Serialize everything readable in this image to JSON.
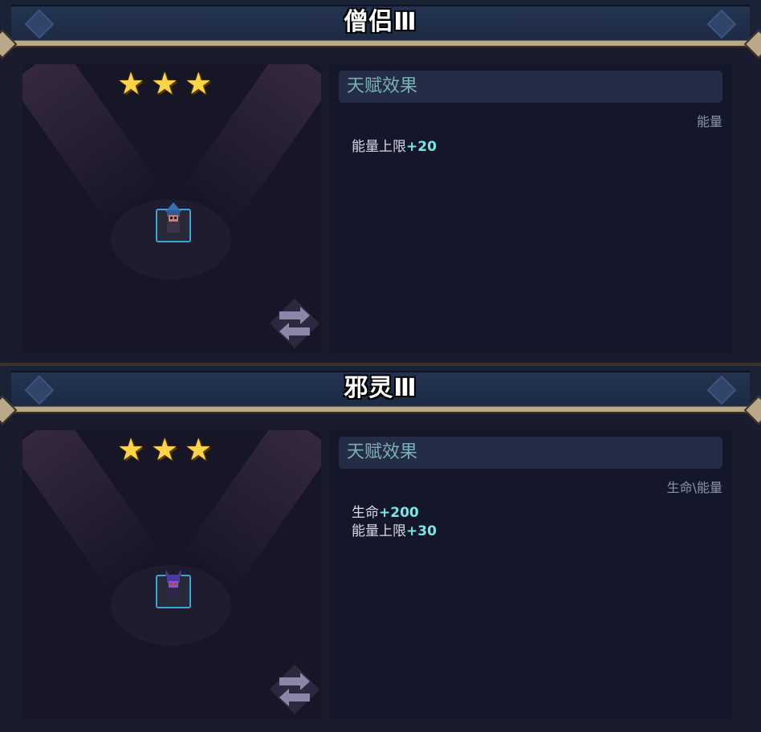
{
  "cards": [
    {
      "title": "僧侣Ⅲ",
      "stars": 3,
      "talent_header": "天赋效果",
      "category": "能量",
      "effects": [
        {
          "label": "能量上限",
          "bonus": "+20"
        }
      ],
      "avatar_hood_color": "#3a6fb5",
      "avatar_face_color": "#c97f7f"
    },
    {
      "title": "邪灵Ⅲ",
      "stars": 3,
      "talent_header": "天赋效果",
      "category": "生命\\能量",
      "effects": [
        {
          "label": "生命",
          "bonus": "+200"
        },
        {
          "label": "能量上限",
          "bonus": "+30"
        }
      ],
      "avatar_hood_color": "#4b3aa0",
      "avatar_face_color": "#7a5bd0"
    }
  ],
  "colors": {
    "accent_bonus": "#79e6e6",
    "star": "#ffd447",
    "frame_border": "#38a6d9"
  },
  "icons": {
    "star": "star-icon",
    "swap": "swap-icon"
  }
}
